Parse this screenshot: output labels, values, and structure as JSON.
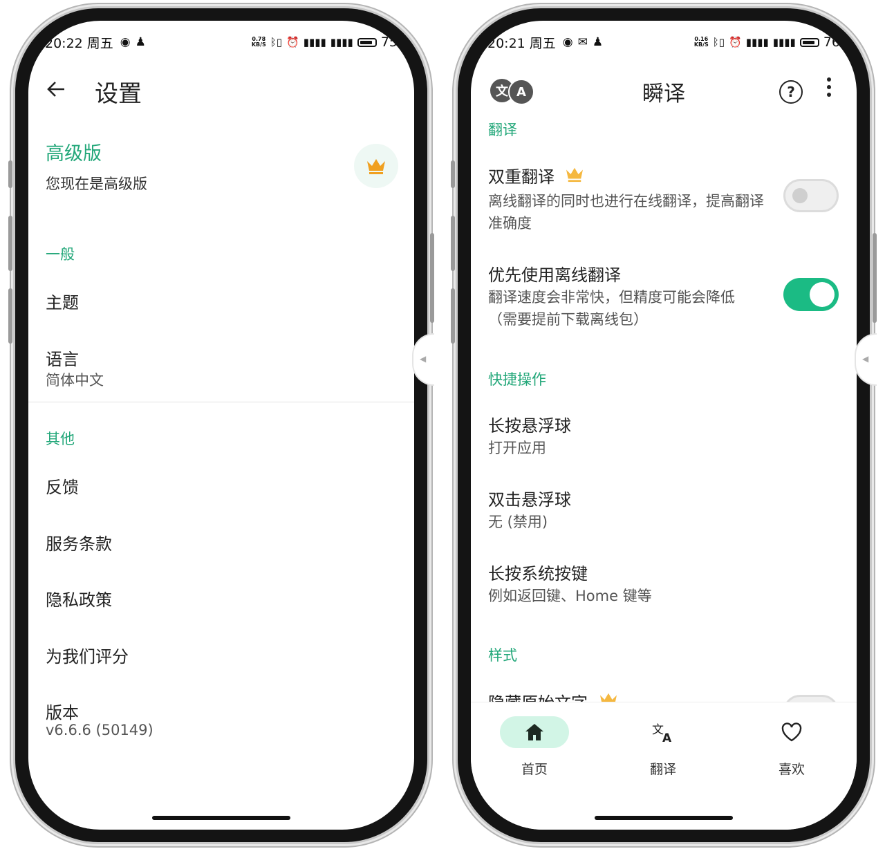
{
  "left_phone": {
    "status": {
      "time": "20:22 周五",
      "speed": "0.78",
      "speed_unit": "KB/S",
      "battery": "75"
    },
    "header": {
      "title": "设置"
    },
    "premium": {
      "title": "高级版",
      "subtitle": "您现在是高级版"
    },
    "sections": [
      {
        "label": "一般",
        "items": [
          {
            "title": "主题"
          },
          {
            "title": "语言",
            "subtitle": "简体中文"
          }
        ]
      },
      {
        "label": "其他",
        "items": [
          {
            "title": "反馈"
          },
          {
            "title": "服务条款"
          },
          {
            "title": "隐私政策"
          },
          {
            "title": "为我们评分"
          },
          {
            "title": "版本",
            "subtitle": "v6.6.6 (50149)"
          }
        ]
      }
    ]
  },
  "right_phone": {
    "status": {
      "time": "20:21 周五",
      "speed": "0.16",
      "speed_unit": "KB/S",
      "battery": "76"
    },
    "topbar": {
      "badge_left": "文",
      "badge_right": "A",
      "title": "瞬译",
      "help": "?"
    },
    "sections": [
      {
        "label": "翻译",
        "items": [
          {
            "title": "双重翻译",
            "subtitle": "离线翻译的同时也进行在线翻译，提高翻译准确度",
            "premium": true,
            "toggle": false
          },
          {
            "title": "优先使用离线翻译",
            "subtitle": "翻译速度会非常快，但精度可能会降低（需要提前下载离线包）",
            "toggle": true
          }
        ]
      },
      {
        "label": "快捷操作",
        "items": [
          {
            "title": "长按悬浮球",
            "subtitle": "打开应用"
          },
          {
            "title": "双击悬浮球",
            "subtitle": "无 (禁用)"
          },
          {
            "title": "长按系统按键",
            "subtitle": "例如返回键、Home 键等"
          }
        ]
      },
      {
        "label": "样式",
        "items": [
          {
            "title": "隐藏原始文字",
            "premium": true
          }
        ]
      }
    ],
    "bottom_nav": [
      {
        "label": "首页",
        "icon": "home-icon",
        "active": true
      },
      {
        "label": "翻译",
        "icon": "translate-icon",
        "active": false
      },
      {
        "label": "喜欢",
        "icon": "heart-icon",
        "active": false
      }
    ]
  },
  "colors": {
    "accent": "#22a779",
    "toggle_on": "#1bbb84",
    "crown": "#f0a020",
    "nav_active": "#d2f5e6"
  }
}
